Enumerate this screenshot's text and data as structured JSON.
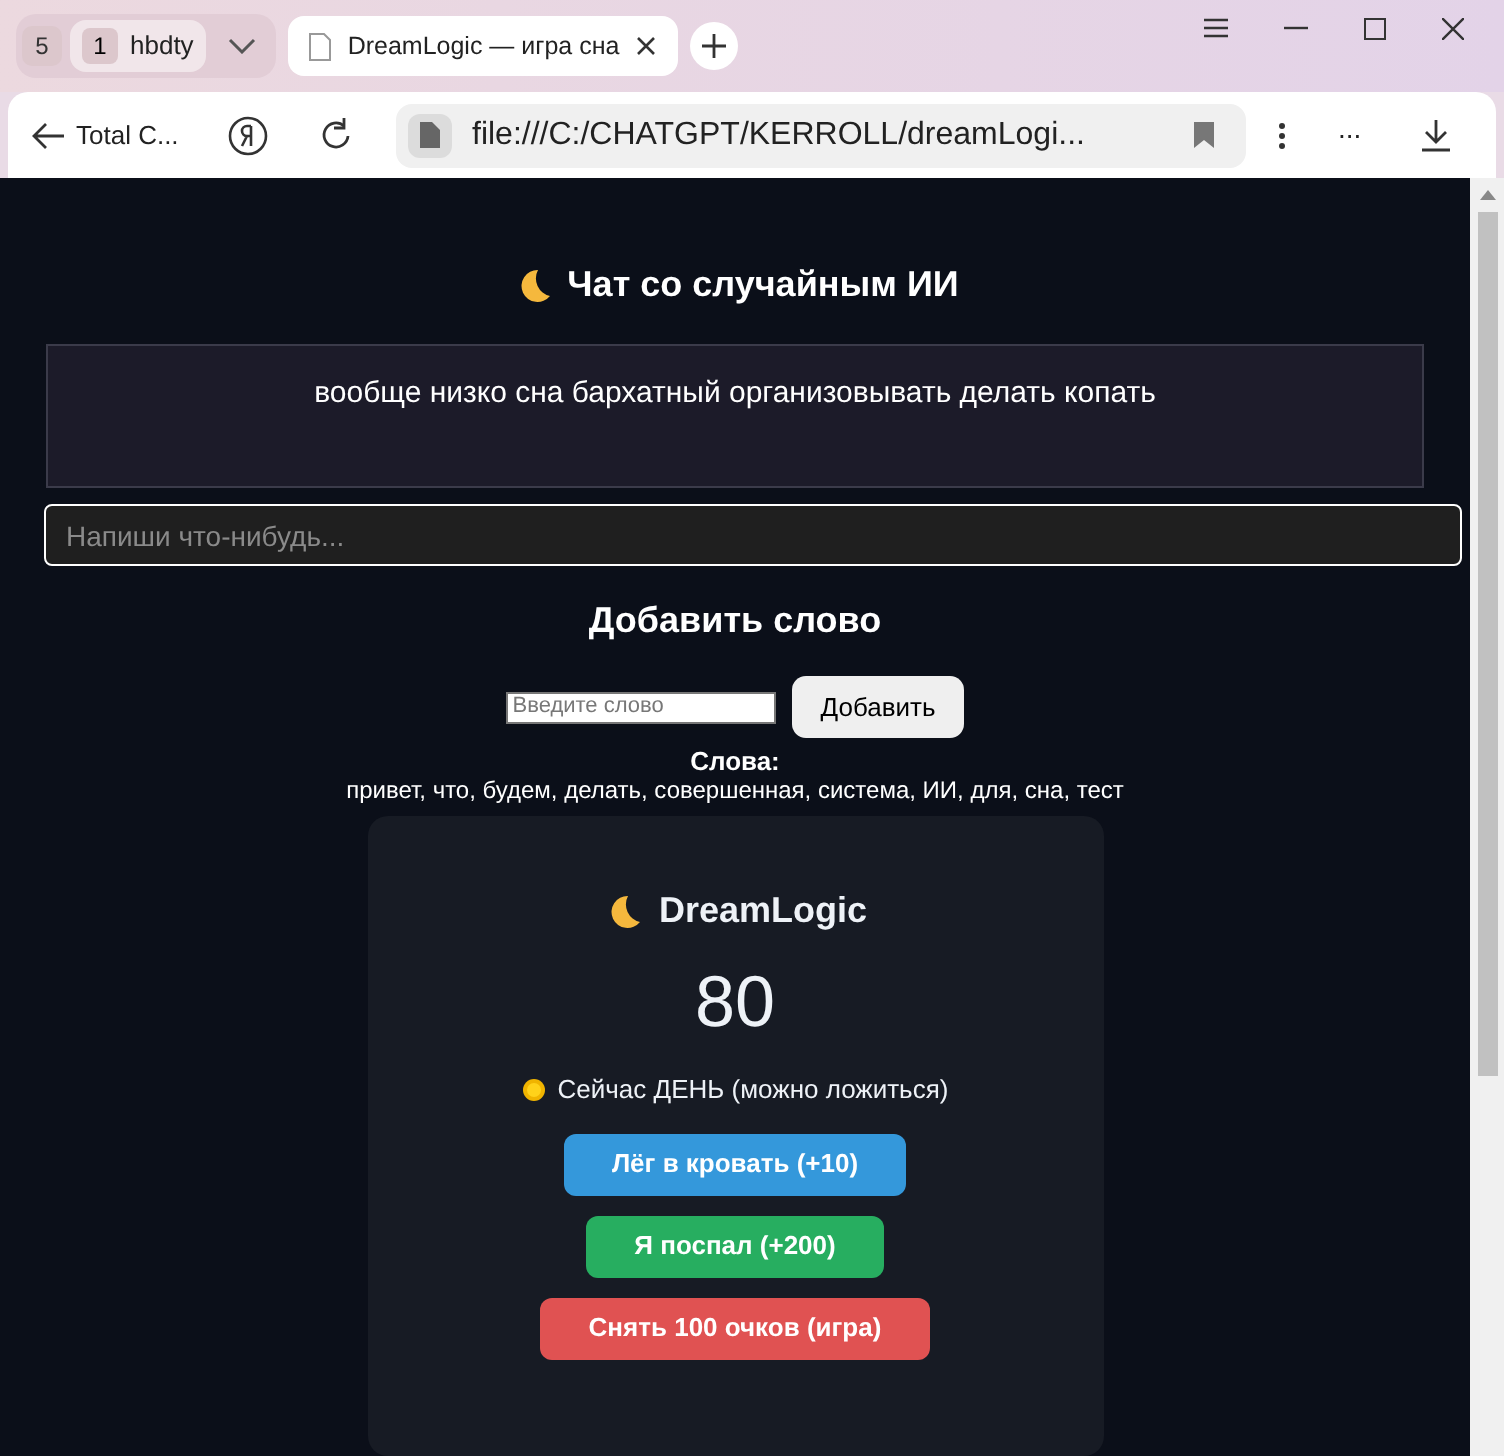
{
  "browser": {
    "tab_group_count": "5",
    "tabs": [
      {
        "badge": "1",
        "title": "hbdty",
        "selected": false
      },
      {
        "title": "DreamLogic — игра сна",
        "selected": true
      }
    ],
    "back_label": "Total C...",
    "url": "file:///C:/CHATGPT/KERROLL/dreamLogi...",
    "overflow_label": "..."
  },
  "chat": {
    "title": "Чат со случайным ИИ",
    "message": "вообще низко сна бархатный организовывать делать копать",
    "input_placeholder": "Напиши что-нибудь..."
  },
  "add_word": {
    "title": "Добавить слово",
    "input_placeholder": "Введите слово",
    "button": "Добавить",
    "words_label": "Слова:",
    "words": "привет, что, будем, делать, совершенная, система, ИИ, для, сна, тест"
  },
  "card": {
    "title": "DreamLogic",
    "score": "80",
    "status": "Сейчас ДЕНЬ (можно ложиться)",
    "buttons": [
      {
        "label": "Лёг в кровать (+10)",
        "color": "#3498db"
      },
      {
        "label": "Я поспал (+200)",
        "color": "#27ae60"
      },
      {
        "label": "Снять 100 очков (игра)",
        "color": "#e05252"
      }
    ]
  }
}
